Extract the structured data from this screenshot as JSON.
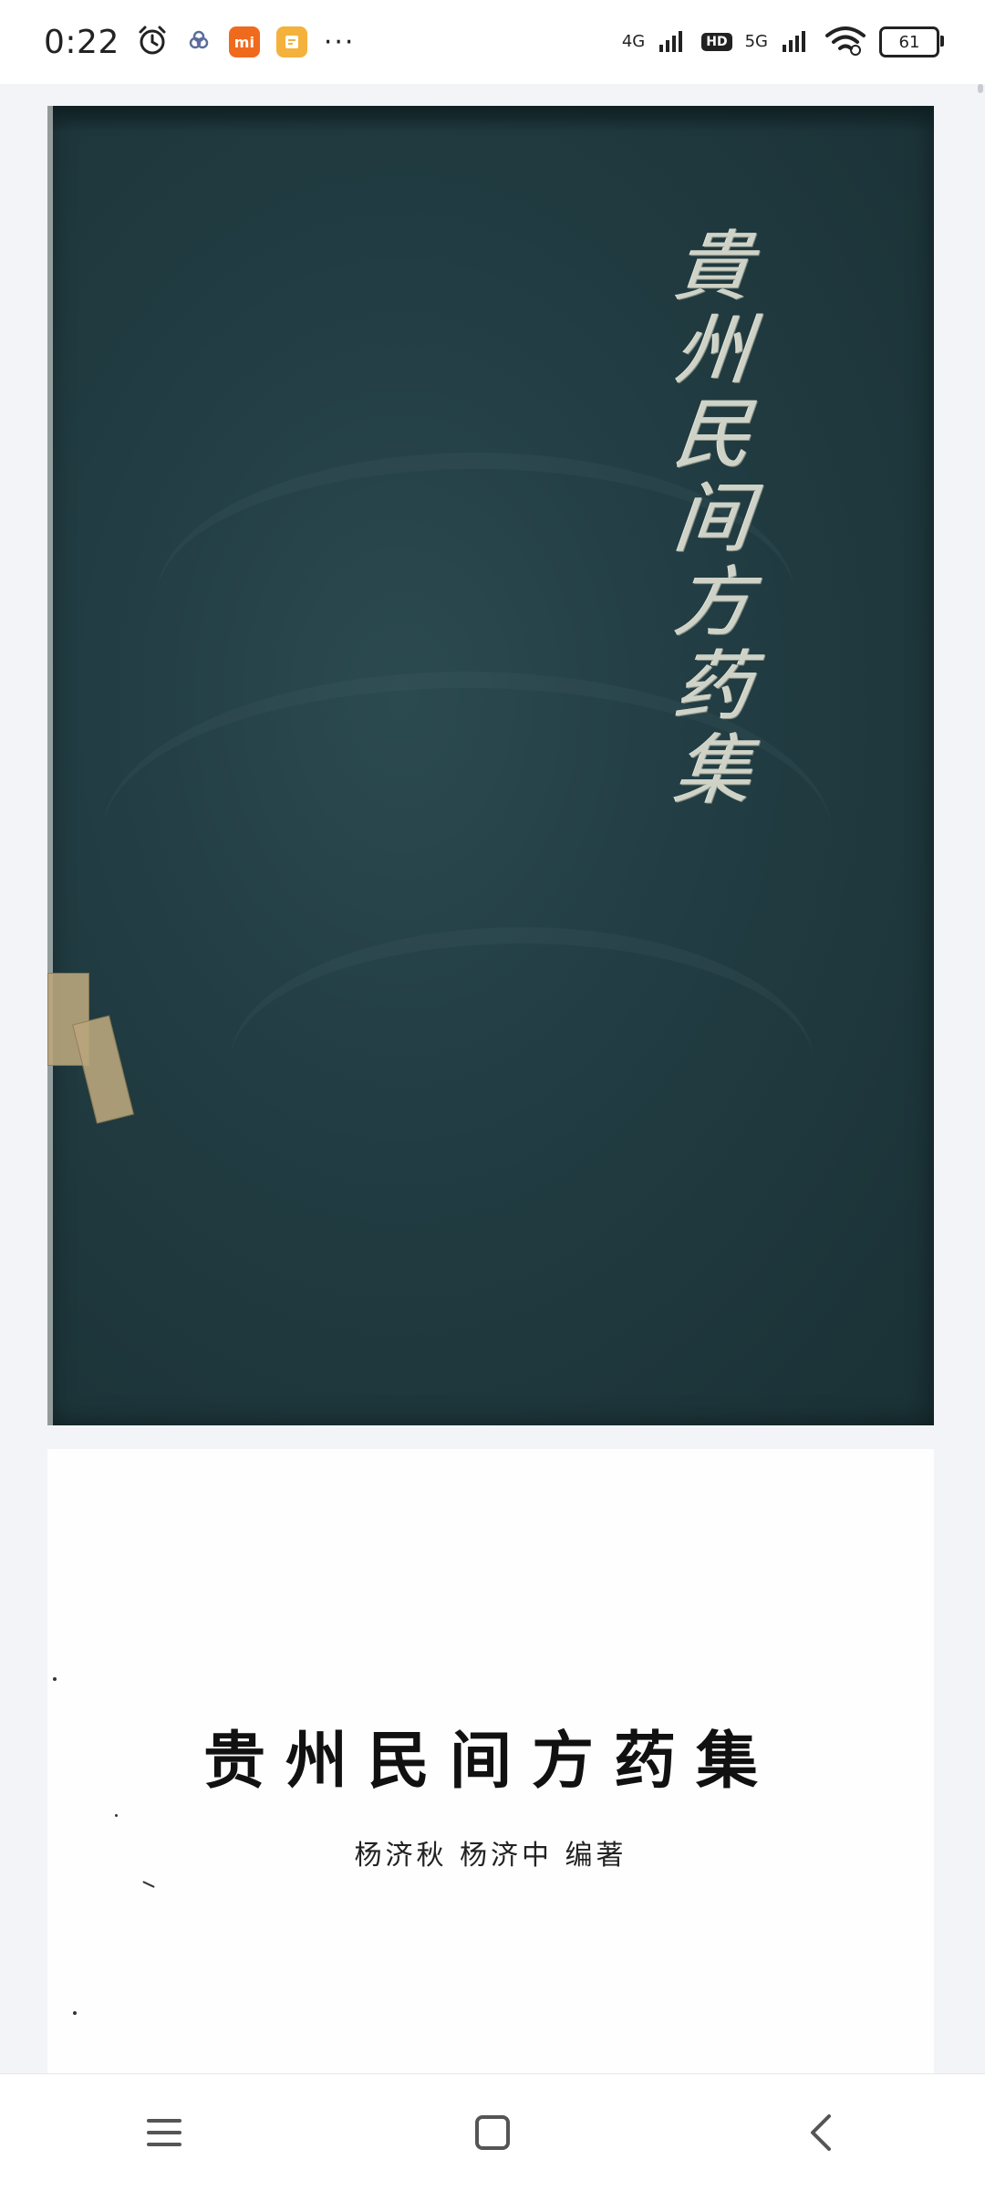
{
  "status_bar": {
    "time": "0:22",
    "network_1": "4G",
    "hd_label": "HD",
    "network_2": "5G",
    "battery": "61",
    "overflow": "···",
    "icons": [
      "alarm-icon",
      "cloud-sync-icon",
      "mi-app-icon",
      "notes-app-icon",
      "signal-icon",
      "wifi-icon",
      "battery-icon"
    ]
  },
  "cover": {
    "title_chars": [
      "貴",
      "州",
      "民",
      "间",
      "方",
      "药",
      "集"
    ],
    "background": "#213c42"
  },
  "title_page": {
    "title": "贵州民间方药集",
    "authors": "杨济秋  杨济中  编著"
  },
  "nav_bar": {
    "icons": [
      "menu-icon",
      "home-icon",
      "back-icon"
    ]
  }
}
